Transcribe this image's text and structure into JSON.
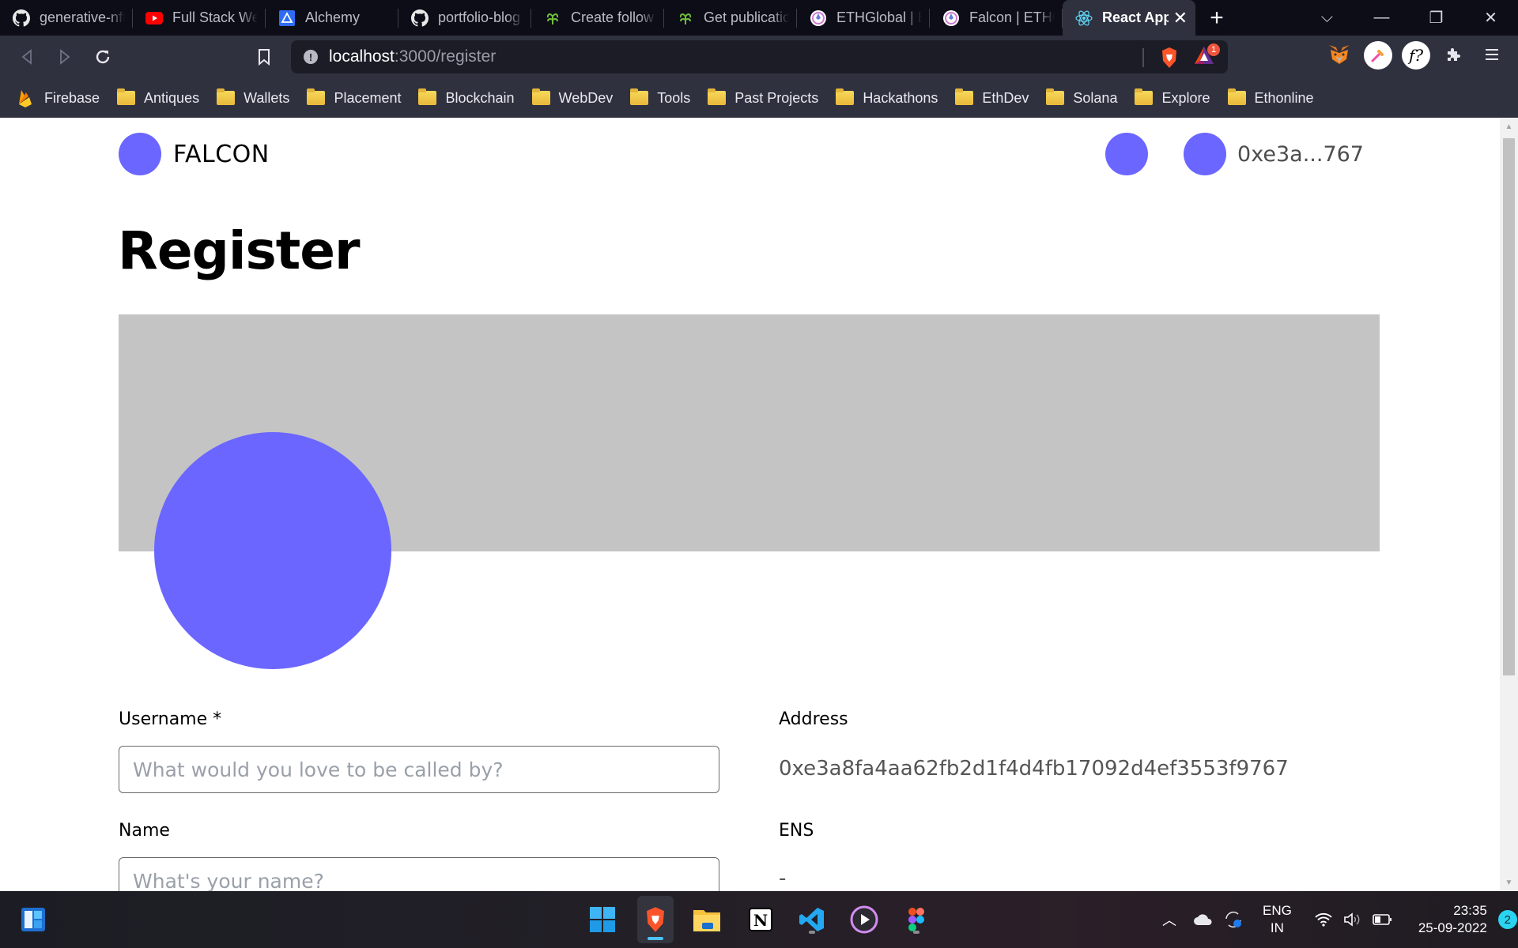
{
  "browser": {
    "tabs": [
      {
        "title": "generative-nft",
        "icon": "github-icon"
      },
      {
        "title": "Full Stack Web",
        "icon": "youtube-icon"
      },
      {
        "title": "Alchemy",
        "icon": "alchemy-icon"
      },
      {
        "title": "portfolio-blog",
        "icon": "github-icon"
      },
      {
        "title": "Create follow",
        "icon": "lens-icon"
      },
      {
        "title": "Get publicatio",
        "icon": "lens-icon"
      },
      {
        "title": "ETHGlobal | ET",
        "icon": "ethglobal-icon"
      },
      {
        "title": "Falcon | ETHGl",
        "icon": "ethglobal-icon"
      },
      {
        "title": "React App",
        "icon": "react-icon",
        "active": true
      }
    ],
    "new_tab_label": "+",
    "close_tab_label": "✕",
    "window_controls": {
      "dropdown": "⌵",
      "minimize": "—",
      "restore": "❐",
      "close": "✕"
    },
    "address": {
      "host": "localhost",
      "path": ":3000/register"
    },
    "shield_badge_count": "1",
    "bookmarks": [
      {
        "label": "Firebase",
        "type": "firebase"
      },
      {
        "label": "Antiques",
        "type": "folder"
      },
      {
        "label": "Wallets",
        "type": "folder"
      },
      {
        "label": "Placement",
        "type": "folder"
      },
      {
        "label": "Blockchain",
        "type": "folder"
      },
      {
        "label": "WebDev",
        "type": "folder"
      },
      {
        "label": "Tools",
        "type": "folder"
      },
      {
        "label": "Past Projects",
        "type": "folder"
      },
      {
        "label": "Hackathons",
        "type": "folder"
      },
      {
        "label": "EthDev",
        "type": "folder"
      },
      {
        "label": "Solana",
        "type": "folder"
      },
      {
        "label": "Explore",
        "type": "folder"
      },
      {
        "label": "Ethonline",
        "type": "folder"
      }
    ]
  },
  "app": {
    "brand": "FALCON",
    "accent_color": "#6b66ff",
    "wallet_short": "0xe3a...767",
    "page_title": "Register",
    "form": {
      "username": {
        "label": "Username *",
        "placeholder": "What would you love to be called by?",
        "value": ""
      },
      "name": {
        "label": "Name",
        "placeholder": "What's your name?",
        "value": ""
      },
      "address": {
        "label": "Address",
        "value": "0xe3a8fa4aa62fb2d1f4d4fb17092d4ef3553f9767"
      },
      "ens": {
        "label": "ENS",
        "value": "-"
      }
    }
  },
  "taskbar": {
    "apps": [
      "widgets-icon",
      "start-icon",
      "brave-icon",
      "file-explorer-icon",
      "notion-icon",
      "vscode-icon",
      "media-player-icon",
      "figma-icon"
    ],
    "language": {
      "line1": "ENG",
      "line2": "IN"
    },
    "time": "23:35",
    "date": "25-09-2022",
    "notification_count": "2"
  }
}
